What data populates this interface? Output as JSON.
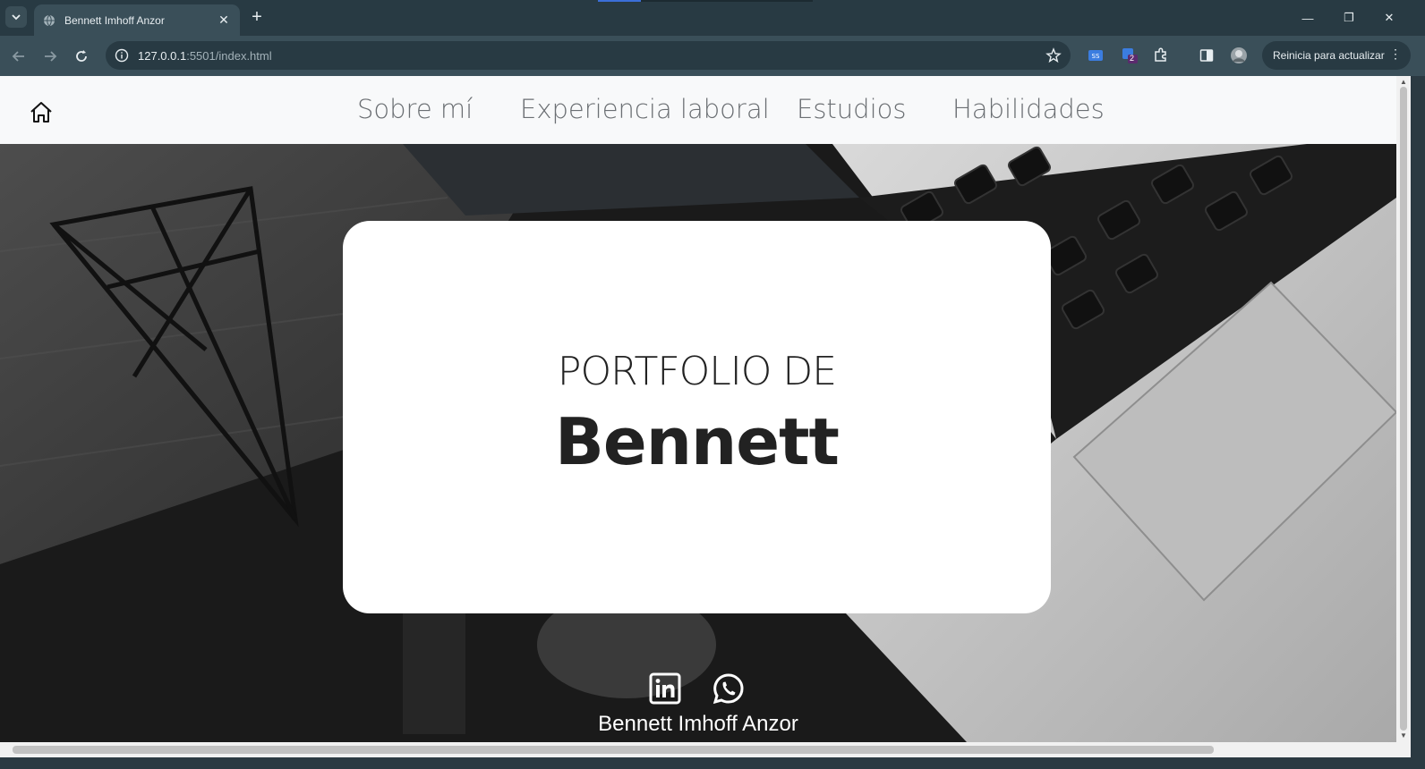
{
  "browser": {
    "tab_title": "Bennett Imhoff Anzor",
    "url_host": "127.0.0.1",
    "url_rest": ":5501/index.html",
    "update_label": "Reinicia para actualizar",
    "extension_badge": "2"
  },
  "nav": {
    "items": [
      {
        "label": "Sobre mí"
      },
      {
        "label": "Experiencia laboral"
      },
      {
        "label": "Estudios"
      },
      {
        "label": "Habilidades"
      }
    ]
  },
  "hero": {
    "subtitle": "PORTFOLIO DE",
    "name": "Bennett",
    "footer_name": "Bennett Imhoff Anzor",
    "social": [
      "linkedin-icon",
      "whatsapp-icon"
    ]
  },
  "colors": {
    "chrome_dark": "#283a43",
    "chrome_mid": "#3a4f59",
    "navbar_bg": "#f8f9fa",
    "nav_text": "#6b6f73",
    "card_bg": "#ffffff"
  }
}
